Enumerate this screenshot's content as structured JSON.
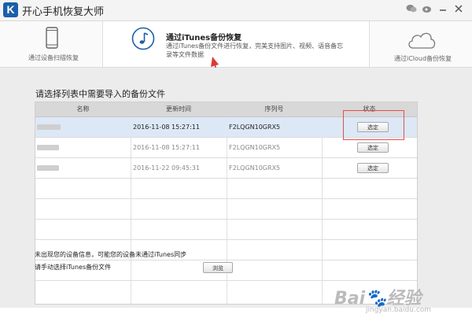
{
  "app": {
    "logo_letter": "K",
    "title": "开心手机恢复大师"
  },
  "modes": {
    "device": {
      "label": "通过设备扫描恢复"
    },
    "itunes": {
      "title": "通过iTunes备份恢复",
      "desc": "通过iTunes备份文件进行恢复，完美支持图片、视频、语音备忘录等文件数据"
    },
    "icloud": {
      "label": "通过iCloud备份恢复"
    }
  },
  "main": {
    "heading": "请选择列表中需要导入的备份文件",
    "columns": [
      "名称",
      "更新时间",
      "序列号",
      "状态"
    ],
    "rows": [
      {
        "time": "2016-11-08 15:27:11",
        "serial": "F2LQGN10GRX5",
        "action": "选定",
        "selected": true
      },
      {
        "time": "2016-11-08 15:27:11",
        "serial": "F2LQGN10GRX5",
        "action": "选定",
        "selected": false
      },
      {
        "time": "2016-11-22 09:45:31",
        "serial": "F2LQGN10GRX5",
        "action": "选定",
        "selected": false
      }
    ]
  },
  "footer": {
    "notice": "未出现您的设备信息，可能您的设备未通过iTunes同步",
    "manual_label": "请手动选择iTunes备份文件",
    "browse_label": "浏览"
  },
  "colors": {
    "accent_blue": "#1b5fa8",
    "selected_row": "#dde8f7",
    "highlight_red": "#e05050"
  }
}
